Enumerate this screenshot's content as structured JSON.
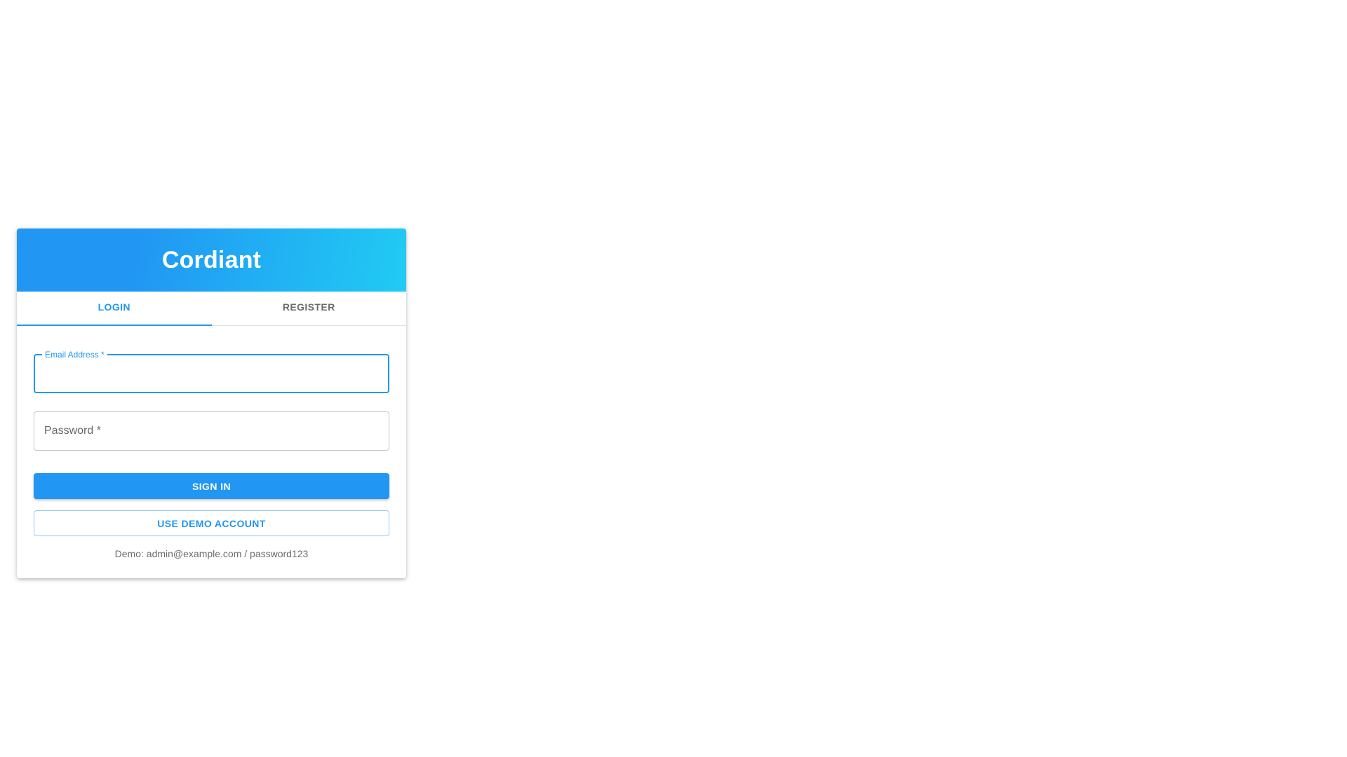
{
  "brand": {
    "title": "Cordiant"
  },
  "tabs": [
    {
      "label": "LOGIN",
      "active": true
    },
    {
      "label": "REGISTER",
      "active": false
    }
  ],
  "form": {
    "email": {
      "label": "Email Address *",
      "value": ""
    },
    "password": {
      "label": "Password *",
      "value": ""
    },
    "sign_in_label": "SIGN IN",
    "demo_button_label": "USE DEMO ACCOUNT",
    "demo_hint": "Demo: admin@example.com / password123"
  },
  "colors": {
    "primary": "#2196f3",
    "gradient_end": "#21cbf3"
  }
}
